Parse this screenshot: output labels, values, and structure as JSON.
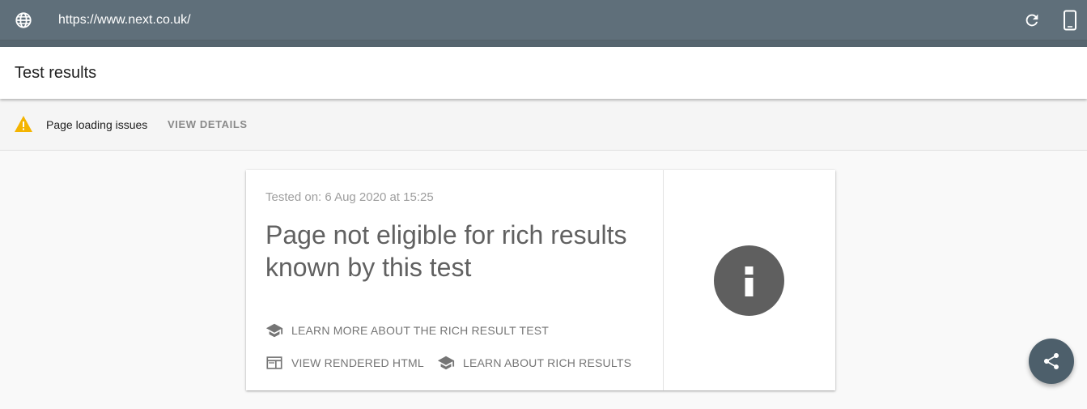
{
  "urlbar": {
    "url": "https://www.next.co.uk/",
    "icons": {
      "left": "globe-icon",
      "reload": "reload-icon",
      "device": "mobile-device-icon"
    }
  },
  "header": {
    "title": "Test results"
  },
  "issues": {
    "icon": "warning-icon",
    "icon_color": "#f4b400",
    "text": "Page loading issues",
    "action_label": "VIEW DETAILS"
  },
  "card": {
    "tested_on": "Tested on: 6 Aug 2020 at 15:25",
    "headline": "Page not eligible for rich results known by this test",
    "links": {
      "learn_more": {
        "label": "LEARN MORE ABOUT THE RICH RESULT TEST",
        "icon": "school-icon"
      },
      "view_html": {
        "label": "VIEW RENDERED HTML",
        "icon": "web-icon"
      },
      "learn_rich": {
        "label": "LEARN ABOUT RICH RESULTS",
        "icon": "school-icon"
      }
    },
    "status_icon": "info-icon"
  },
  "fab": {
    "icon": "share-icon"
  },
  "colors": {
    "urlbar": "#5f6f7a",
    "fab": "#4d5f6b",
    "info": "#5f5f5f"
  }
}
